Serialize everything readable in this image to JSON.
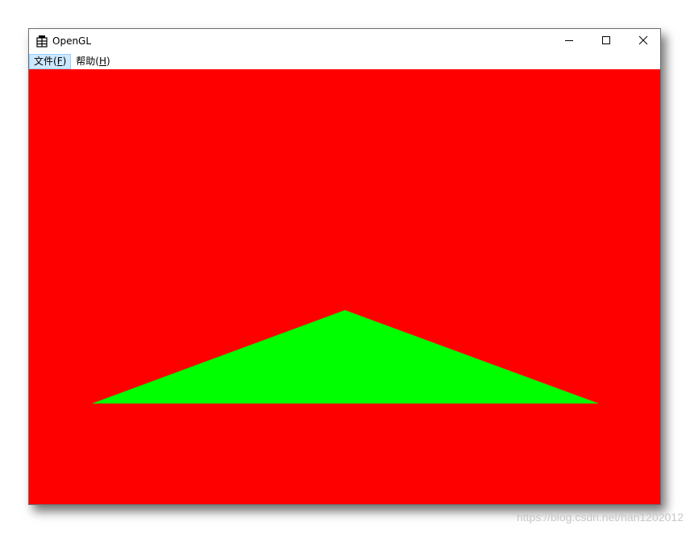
{
  "window": {
    "title": "OpenGL",
    "icon": "app-window-icon"
  },
  "caption_buttons": {
    "minimize_icon": "minimize-icon",
    "maximize_icon": "maximize-icon",
    "close_icon": "close-icon"
  },
  "menu": {
    "items": [
      {
        "label": "文件(",
        "mnemonic": "F",
        "suffix": ")"
      },
      {
        "label": "帮助(",
        "mnemonic": "H",
        "suffix": ")"
      }
    ]
  },
  "scene": {
    "background_color": "#ff0000",
    "triangle_color": "#00ff00"
  },
  "watermark": "https://blog.csdn.net/han1202012"
}
